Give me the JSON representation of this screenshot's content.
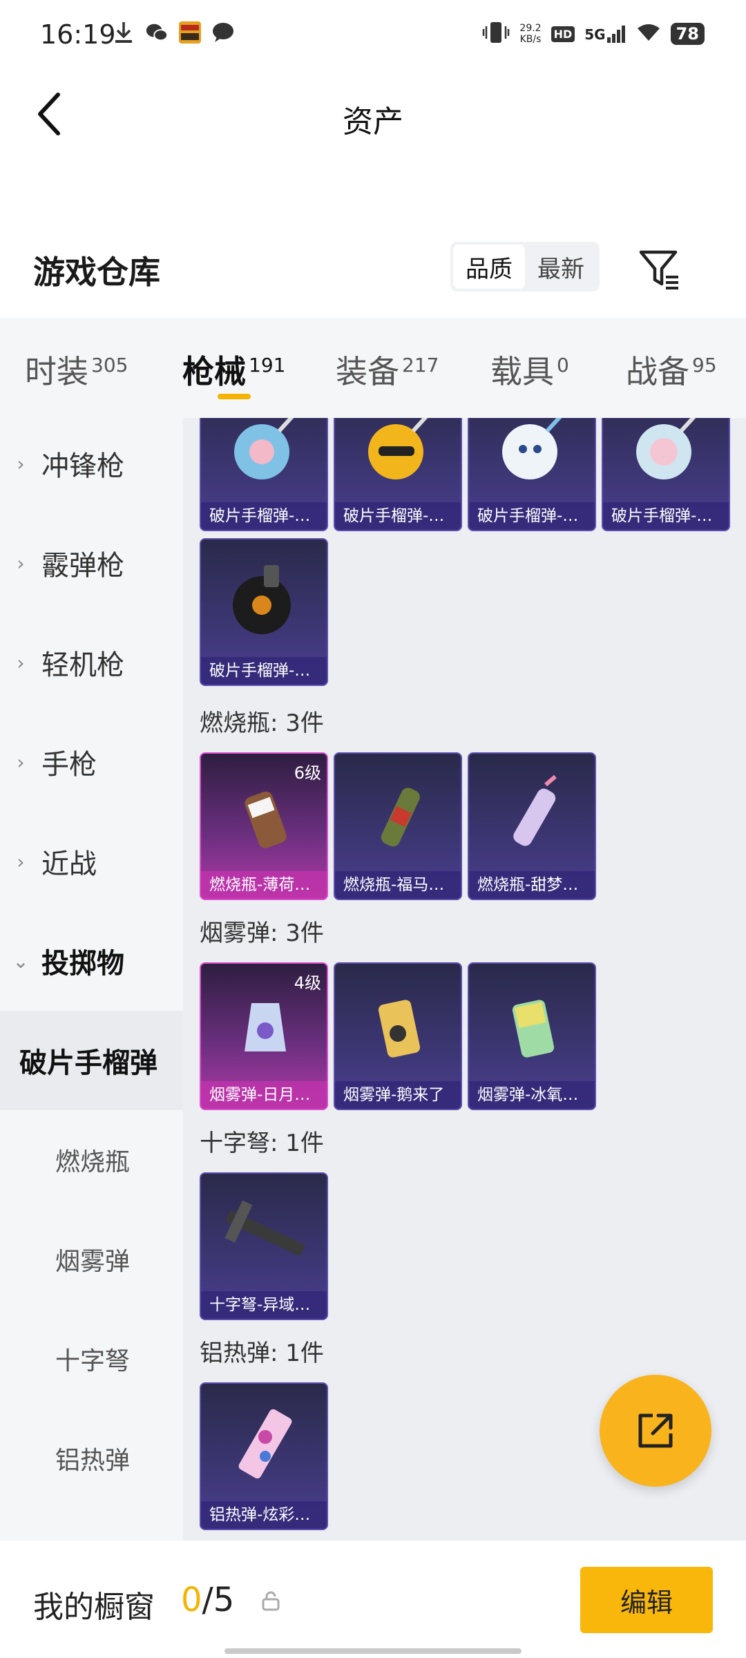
{
  "status": {
    "time": "16:19",
    "speed_value": "29.2",
    "speed_unit": "KB/s",
    "hd": "HD",
    "network": "5G",
    "battery": "78"
  },
  "header": {
    "title": "资产"
  },
  "warehouse": {
    "title": "游戏仓库",
    "sort_options": [
      "品质",
      "最新"
    ],
    "active_sort": "品质"
  },
  "tabs": [
    {
      "label": "时装",
      "count": "305"
    },
    {
      "label": "枪械",
      "count": "191"
    },
    {
      "label": "装备",
      "count": "217"
    },
    {
      "label": "载具",
      "count": "0"
    },
    {
      "label": "战备",
      "count": "95"
    }
  ],
  "active_tab": "枪械",
  "sidebar": {
    "categories": [
      "冲锋枪",
      "霰弹枪",
      "轻机枪",
      "手枪",
      "近战",
      "投掷物"
    ],
    "open_category": "投掷物",
    "subcategories": [
      "破片手榴弹",
      "燃烧瓶",
      "烟雾弹",
      "十字弩",
      "铝热弹"
    ],
    "selected_subcategory": "破片手榴弹"
  },
  "sections": {
    "grenades": {
      "items": [
        "破片手榴弹-…",
        "破片手榴弹-…",
        "破片手榴弹-…",
        "破片手榴弹-…",
        "破片手榴弹-…"
      ]
    },
    "molotov": {
      "title": "燃烧瓶: 3件",
      "items": [
        {
          "name": "燃烧瓶-薄荷…",
          "level": "6级"
        },
        {
          "name": "燃烧瓶-福马…",
          "level": ""
        },
        {
          "name": "燃烧瓶-甜梦…",
          "level": ""
        }
      ]
    },
    "smoke": {
      "title": "烟雾弹: 3件",
      "items": [
        {
          "name": "烟雾弹-日月…",
          "level": "4级"
        },
        {
          "name": "烟雾弹-鹅来了",
          "level": ""
        },
        {
          "name": "烟雾弹-冰氧…",
          "level": ""
        }
      ]
    },
    "crossbow": {
      "title": "十字弩: 1件",
      "items": [
        {
          "name": "十字弩-异域…"
        }
      ]
    },
    "thermite": {
      "title": "铝热弹: 1件",
      "items": [
        {
          "name": "铝热弹-炫彩…"
        }
      ]
    }
  },
  "showcase": {
    "label": "我的橱窗",
    "current": "0",
    "total": "/5",
    "edit_label": "编辑"
  },
  "colors": {
    "accent": "#f5b400",
    "card_blue": "#3b3570",
    "card_purple": "#b23aa8"
  }
}
